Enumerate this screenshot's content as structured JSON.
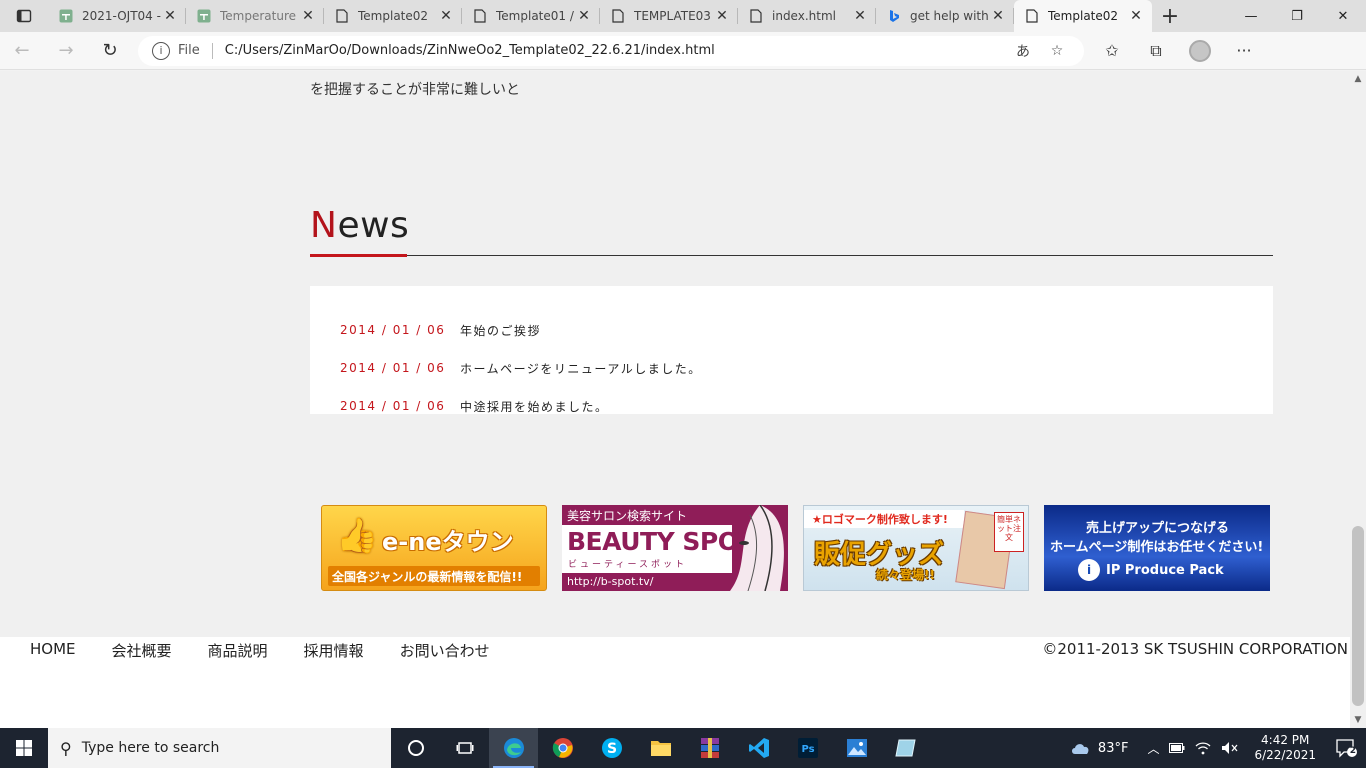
{
  "browser": {
    "tabs": [
      {
        "label": "2021-OJT04 -",
        "icon": "sheets-icon"
      },
      {
        "label": "Temperature",
        "icon": "sheets-icon"
      },
      {
        "label": "Template02",
        "icon": "page-icon"
      },
      {
        "label": "Template01 /",
        "icon": "page-icon"
      },
      {
        "label": "TEMPLATE03",
        "icon": "page-icon"
      },
      {
        "label": "index.html",
        "icon": "page-icon"
      },
      {
        "label": "get help with",
        "icon": "bing-icon"
      },
      {
        "label": "Template02",
        "icon": "page-icon",
        "active": true
      }
    ],
    "file_label": "File",
    "url": "C:/Users/ZinMarOo/Downloads/ZinNweOo2_Template02_22.6.21/index.html"
  },
  "page": {
    "intro_text": "を把握することが非常に難しいと",
    "news": {
      "heading_first": "N",
      "heading_rest": "ews",
      "items": [
        {
          "date": "2014 / 01 / 06",
          "title": "年始のご挨拶"
        },
        {
          "date": "2014 / 01 / 06",
          "title": "ホームページをリニューアルしました。"
        },
        {
          "date": "2014 / 01 / 06",
          "title": "中途採用を始めました。"
        }
      ]
    },
    "banners": [
      {
        "logo": "e-neタウン",
        "tagline": "全国各ジャンルの最新情報を配信!!"
      },
      {
        "top": "美容サロン検索サイト",
        "title": "BEAUTY SPOT",
        "kana": "ビューティースポット",
        "url": "http://b-spot.tv/"
      },
      {
        "top": "★ロゴマーク制作致します!",
        "title": "販促グッズ",
        "sub": "続々登場!!",
        "badge": "簡単ネット注文"
      },
      {
        "line1": "売上げアップにつなげる",
        "line2": "ホームページ制作はお任せください!",
        "brand": "IP Produce Pack"
      }
    ],
    "footer": {
      "nav": [
        "HOME",
        "会社概要",
        "商品説明",
        "採用情報",
        "お問い合わせ"
      ],
      "copyright": "©2011-2013 SK TSUSHIN CORPORATION"
    }
  },
  "taskbar": {
    "search_placeholder": "Type here to search",
    "weather": "83°F",
    "time": "4:42 PM",
    "date": "6/22/2021",
    "notifications": "2"
  },
  "colors": {
    "accent_red": "#c4161c",
    "taskbar_bg": "#1d2430"
  }
}
